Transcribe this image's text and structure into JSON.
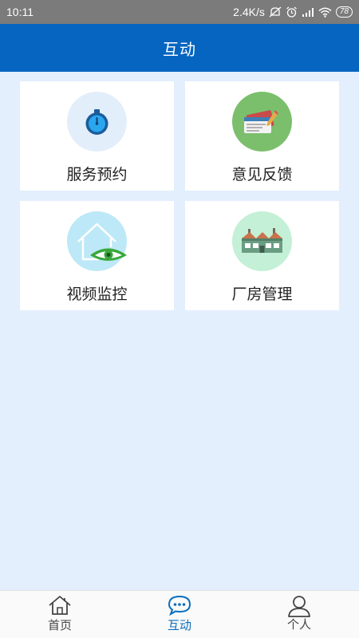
{
  "status_bar": {
    "time": "10:11",
    "network_speed": "2.4K/s",
    "battery_level": "78",
    "icons": [
      "mute-icon",
      "alarm-icon",
      "signal-icon",
      "wifi-icon",
      "battery-icon"
    ]
  },
  "header": {
    "title": "互动"
  },
  "tiles": [
    {
      "label": "服务预约",
      "icon": "stopwatch-icon",
      "circle_color": "#e3eefb"
    },
    {
      "label": "意见反馈",
      "icon": "feedback-cards-icon",
      "circle_color": "#7bbf6c"
    },
    {
      "label": "视频监控",
      "icon": "house-eye-icon",
      "circle_color": "#bde8f7"
    },
    {
      "label": "厂房管理",
      "icon": "factory-icon",
      "circle_color": "#c3f0d6"
    }
  ],
  "tab_bar": {
    "tabs": [
      {
        "label": "首页",
        "icon": "home-icon",
        "active": false
      },
      {
        "label": "互动",
        "icon": "chat-bubble-icon",
        "active": true
      },
      {
        "label": "个人",
        "icon": "person-icon",
        "active": false
      }
    ],
    "active_color": "#0a6ebd"
  },
  "colors": {
    "header": "#0565c0",
    "background": "#e3effd",
    "status_bar": "#7b7b7b"
  }
}
